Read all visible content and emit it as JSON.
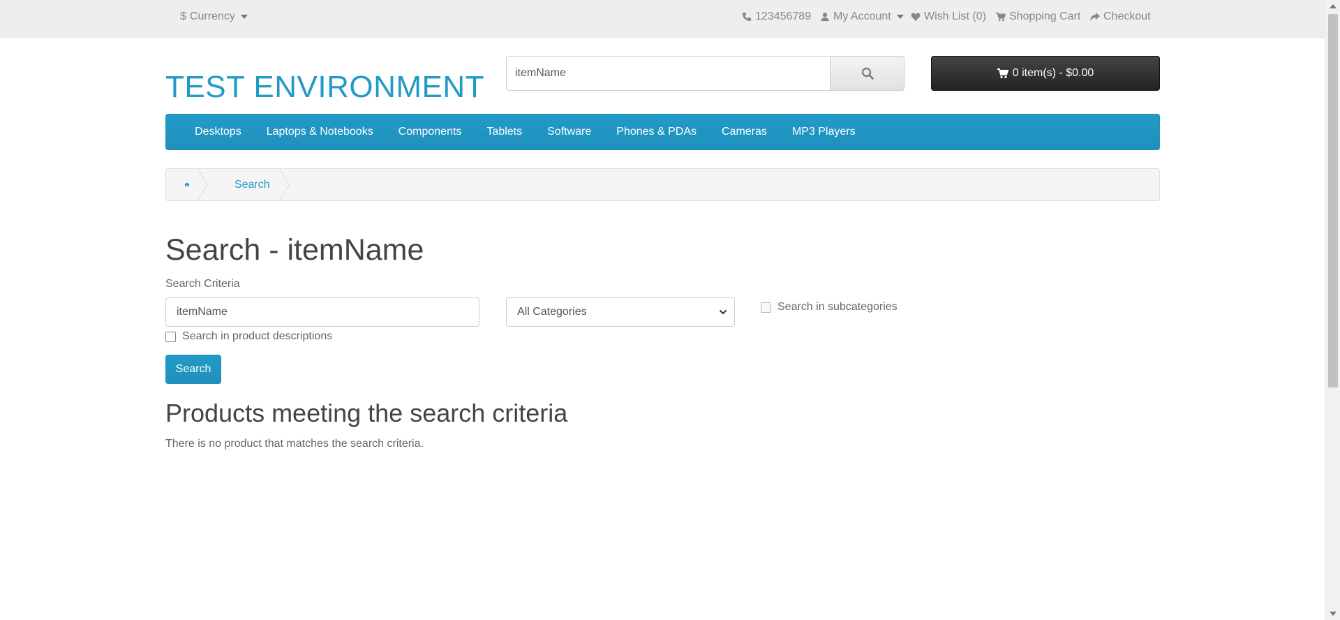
{
  "topbar": {
    "currency_symbol": "$",
    "currency_label": "Currency",
    "phone": "123456789",
    "my_account": "My Account",
    "wish_list": "Wish List (0)",
    "shopping_cart": "Shopping Cart",
    "checkout": "Checkout"
  },
  "header": {
    "logo": "TEST ENVIRONMENT",
    "search_value": "itemName",
    "cart_button": "0 item(s) - $0.00"
  },
  "menu": {
    "items": [
      "Desktops",
      "Laptops & Notebooks",
      "Components",
      "Tablets",
      "Software",
      "Phones & PDAs",
      "Cameras",
      "MP3 Players"
    ]
  },
  "breadcrumb": {
    "search": "Search"
  },
  "content": {
    "title": "Search - itemName",
    "criteria_label": "Search Criteria",
    "keyword_value": "itemName",
    "category_selected": "All Categories",
    "subcategories_label": "Search in subcategories",
    "descriptions_label": "Search in product descriptions",
    "search_button": "Search",
    "results_title": "Products meeting the search criteria",
    "no_results": "There is no product that matches the search criteria."
  },
  "colors": {
    "accent": "#229ac8",
    "cart_button": "#333333",
    "topbar_bg": "#eeeeee"
  }
}
